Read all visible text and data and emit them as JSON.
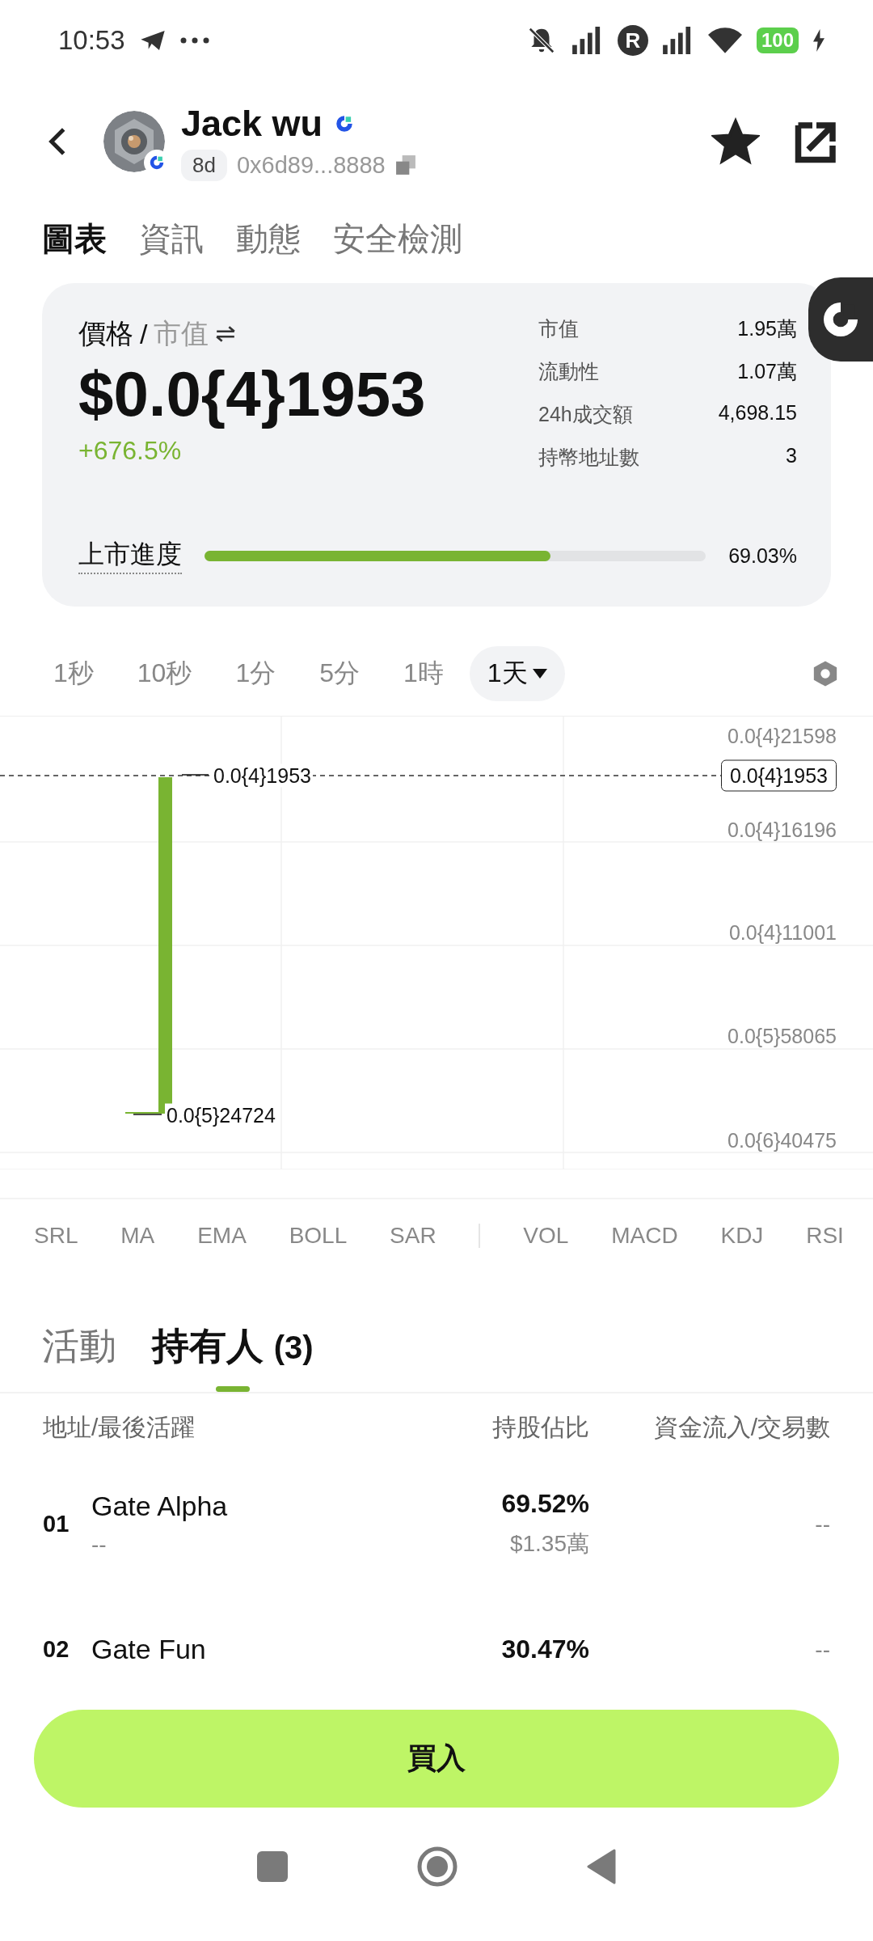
{
  "status_bar": {
    "time": "10:53",
    "sim_badge": "R",
    "battery": "100"
  },
  "header": {
    "name": "Jack wu",
    "age": "8d",
    "address": "0x6d89...8888",
    "favorited": true
  },
  "tabs": [
    {
      "label": "圖表",
      "selected": true
    },
    {
      "label": "資訊",
      "selected": false
    },
    {
      "label": "動態",
      "selected": false
    },
    {
      "label": "安全檢測",
      "selected": false
    }
  ],
  "summary": {
    "price_label": "價格",
    "separator": "/",
    "alt_label": "市值",
    "price": "$0.0{4}1953",
    "change": "+676.5%",
    "stats": [
      {
        "label": "市值",
        "value": "1.95萬"
      },
      {
        "label": "流動性",
        "value": "1.07萬"
      },
      {
        "label": "24h成交額",
        "value": "4,698.15"
      },
      {
        "label": "持幣地址數",
        "value": "3"
      }
    ],
    "progress": {
      "label": "上市進度",
      "level": 0.6903,
      "reading": "69.03%"
    }
  },
  "timeframes": [
    {
      "label": "1秒",
      "selected": false
    },
    {
      "label": "10秒",
      "selected": false
    },
    {
      "label": "1分",
      "selected": false
    },
    {
      "label": "5分",
      "selected": false
    },
    {
      "label": "1時",
      "selected": false
    },
    {
      "label": "1天",
      "selected": true
    }
  ],
  "chart": {
    "y_labels": [
      "0.0{4}21598",
      "0.0{4}16196",
      "0.0{4}11001",
      "0.0{5}58065",
      "0.0{6}40475"
    ],
    "current_price": "0.0{4}1953",
    "high_label": "0.0{4}1953",
    "low_label": "0.0{5}24724"
  },
  "indicators": {
    "main": [
      "SRL",
      "MA",
      "EMA",
      "BOLL",
      "SAR"
    ],
    "sub": [
      "VOL",
      "MACD",
      "KDJ",
      "RSI"
    ]
  },
  "holder_tabs": [
    {
      "label": "活動",
      "selected": false
    },
    {
      "label": "持有人",
      "count": "(3)",
      "selected": true
    }
  ],
  "holders": {
    "columns": [
      "地址/最後活躍",
      "持股佔比",
      "資金流入/交易數"
    ],
    "rows": [
      {
        "rank": "01",
        "name": "Gate Alpha",
        "last_active": "--",
        "share": "69.52%",
        "value": "$1.35萬",
        "flow": "--"
      },
      {
        "rank": "02",
        "name": "Gate Fun",
        "share": "30.47%",
        "flow": "--"
      }
    ]
  },
  "buy_button": "買入"
}
